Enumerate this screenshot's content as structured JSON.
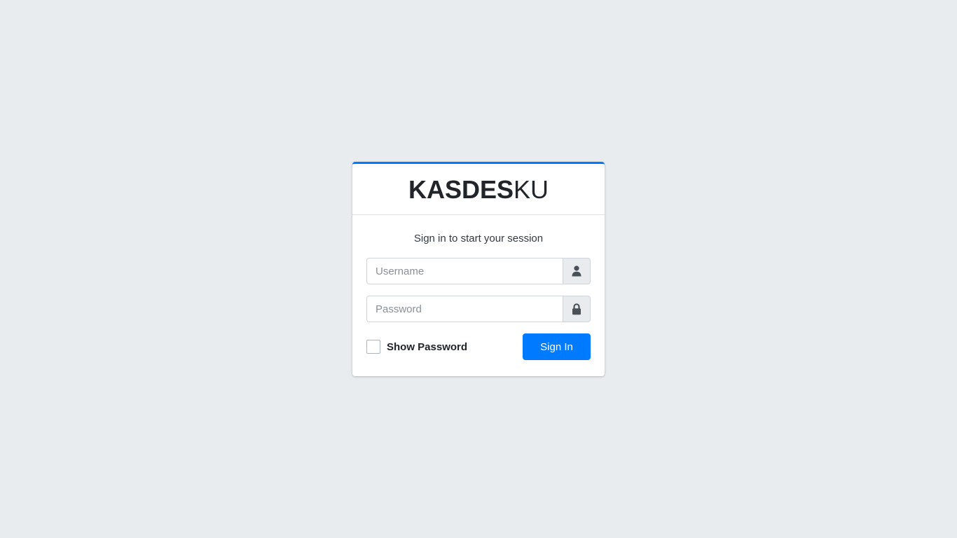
{
  "brand": {
    "bold": "KASDES",
    "light": "KU"
  },
  "login": {
    "message": "Sign in to start your session",
    "username_placeholder": "Username",
    "username_value": "",
    "password_placeholder": "Password",
    "password_value": "",
    "show_password_label": "Show Password",
    "show_password_checked": false,
    "submit_label": "Sign In"
  },
  "icons": {
    "username": "user-icon",
    "password": "lock-icon"
  },
  "colors": {
    "accent": "#007bff",
    "background": "#e9ecef",
    "card": "#ffffff"
  }
}
